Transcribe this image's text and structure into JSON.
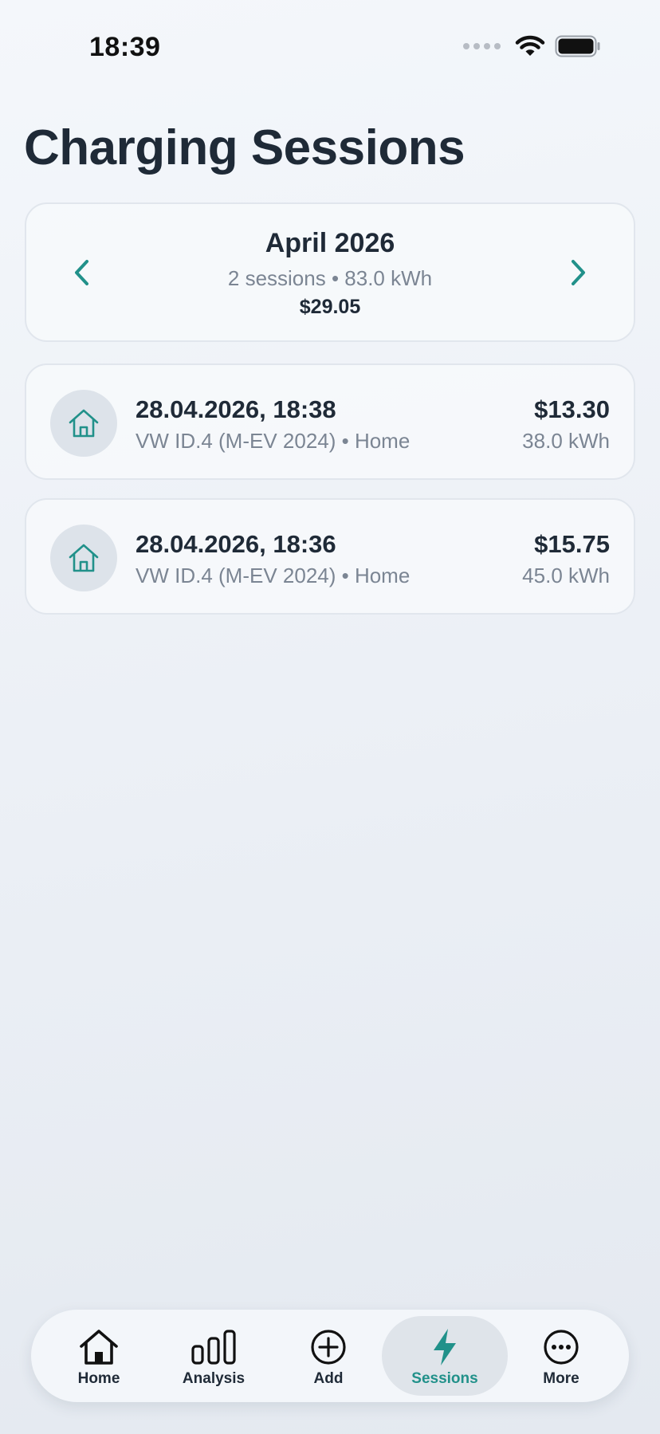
{
  "status_bar": {
    "time": "18:39"
  },
  "page": {
    "title": "Charging Sessions"
  },
  "month_summary": {
    "title": "April 2026",
    "subtitle": "2 sessions • 83.0 kWh",
    "total": "$29.05"
  },
  "sessions": [
    {
      "datetime": "28.04.2026, 18:38",
      "meta": "VW ID.4 (M-EV 2024) • Home",
      "cost": "$13.30",
      "energy": "38.0 kWh",
      "icon": "house-icon"
    },
    {
      "datetime": "28.04.2026, 18:36",
      "meta": "VW ID.4 (M-EV 2024) • Home",
      "cost": "$15.75",
      "energy": "45.0 kWh",
      "icon": "house-icon"
    }
  ],
  "tabs": [
    {
      "label": "Home",
      "icon": "home-icon"
    },
    {
      "label": "Analysis",
      "icon": "bar-chart-icon"
    },
    {
      "label": "Add",
      "icon": "add-circle-icon"
    },
    {
      "label": "Sessions",
      "icon": "bolt-icon",
      "active": true
    },
    {
      "label": "More",
      "icon": "more-icon"
    }
  ],
  "colors": {
    "accent": "#21918a",
    "text": "#1f2a37",
    "muted": "#7b8593"
  }
}
